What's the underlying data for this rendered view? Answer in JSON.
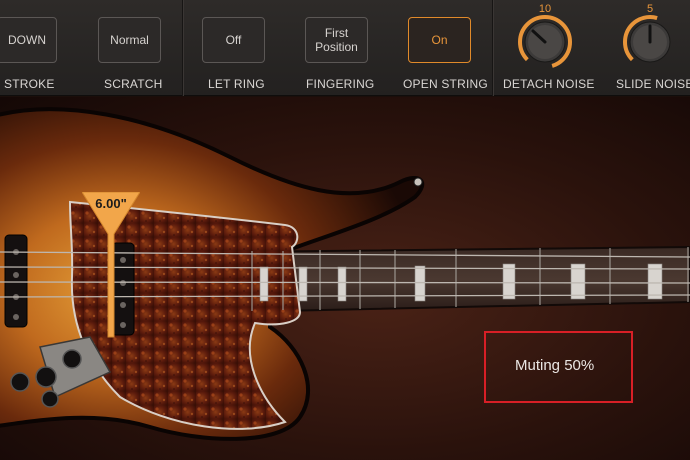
{
  "controls": {
    "stroke": {
      "value": "DOWN",
      "label": "STROKE"
    },
    "scratch": {
      "value": "Normal",
      "label": "SCRATCH"
    },
    "let_ring": {
      "value": "Off",
      "label": "LET RING"
    },
    "fingering": {
      "value": "First\nPosition",
      "label": "FINGERING"
    },
    "open_string": {
      "value": "On",
      "label": "OPEN STRING"
    },
    "detach_noise": {
      "value": "10",
      "label": "DETACH NOISE",
      "level": 1.0
    },
    "slide_noise": {
      "value": "5",
      "label": "SLIDE NOISE",
      "level": 0.5
    }
  },
  "pick_position": {
    "label": "6.00\""
  },
  "muting": {
    "text": "Muting 50%"
  },
  "colors": {
    "accent": "#e8953a",
    "highlight": "#d81f26",
    "body_sunburst": "#b5651d",
    "pickguard": "#5a1a0c"
  }
}
